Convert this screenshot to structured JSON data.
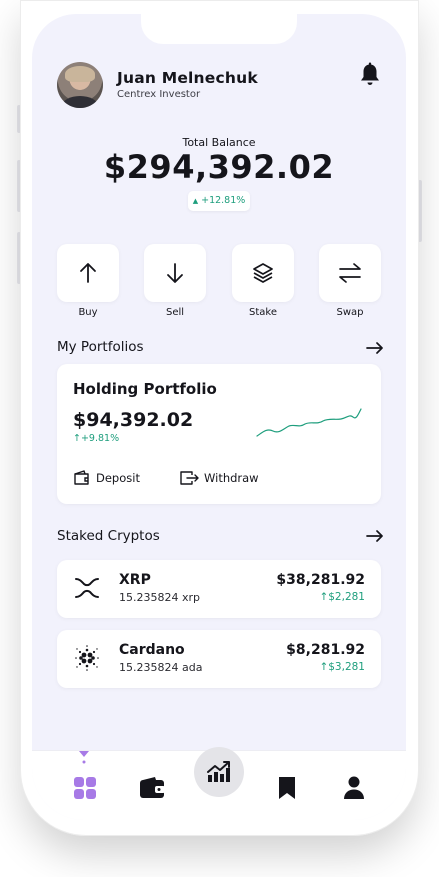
{
  "user": {
    "name": "Juan Melnechuk",
    "role": "Centrex Investor"
  },
  "balance": {
    "label": "Total Balance",
    "value": "$294,392.02",
    "change": "+12.81%"
  },
  "actions": [
    {
      "label": "Buy",
      "icon": "arrow-up-icon"
    },
    {
      "label": "Sell",
      "icon": "arrow-down-icon"
    },
    {
      "label": "Stake",
      "icon": "layers-icon"
    },
    {
      "label": "Swap",
      "icon": "swap-icon"
    }
  ],
  "portfolios": {
    "section_title": "My Portfolios",
    "card": {
      "title": "Holding Portfolio",
      "value": "$94,392.02",
      "change": "+9.81%",
      "deposit_label": "Deposit",
      "withdraw_label": "Withdraw"
    }
  },
  "staked": {
    "section_title": "Staked Cryptos",
    "items": [
      {
        "name": "XRP",
        "amount": "15.235824 xrp",
        "value": "$38,281.92",
        "change": "$2,281",
        "icon": "xrp-icon"
      },
      {
        "name": "Cardano",
        "amount": "15.235824 ada",
        "value": "$8,281.92",
        "change": "$3,281",
        "icon": "cardano-icon"
      }
    ]
  },
  "nav": [
    "dashboard-icon",
    "wallet-icon",
    "chart-icon",
    "bookmark-icon",
    "profile-icon"
  ],
  "colors": {
    "accent": "#a77ae6",
    "positive": "#1e9e7d",
    "background": "#f2f2fc",
    "text": "#15151b"
  }
}
